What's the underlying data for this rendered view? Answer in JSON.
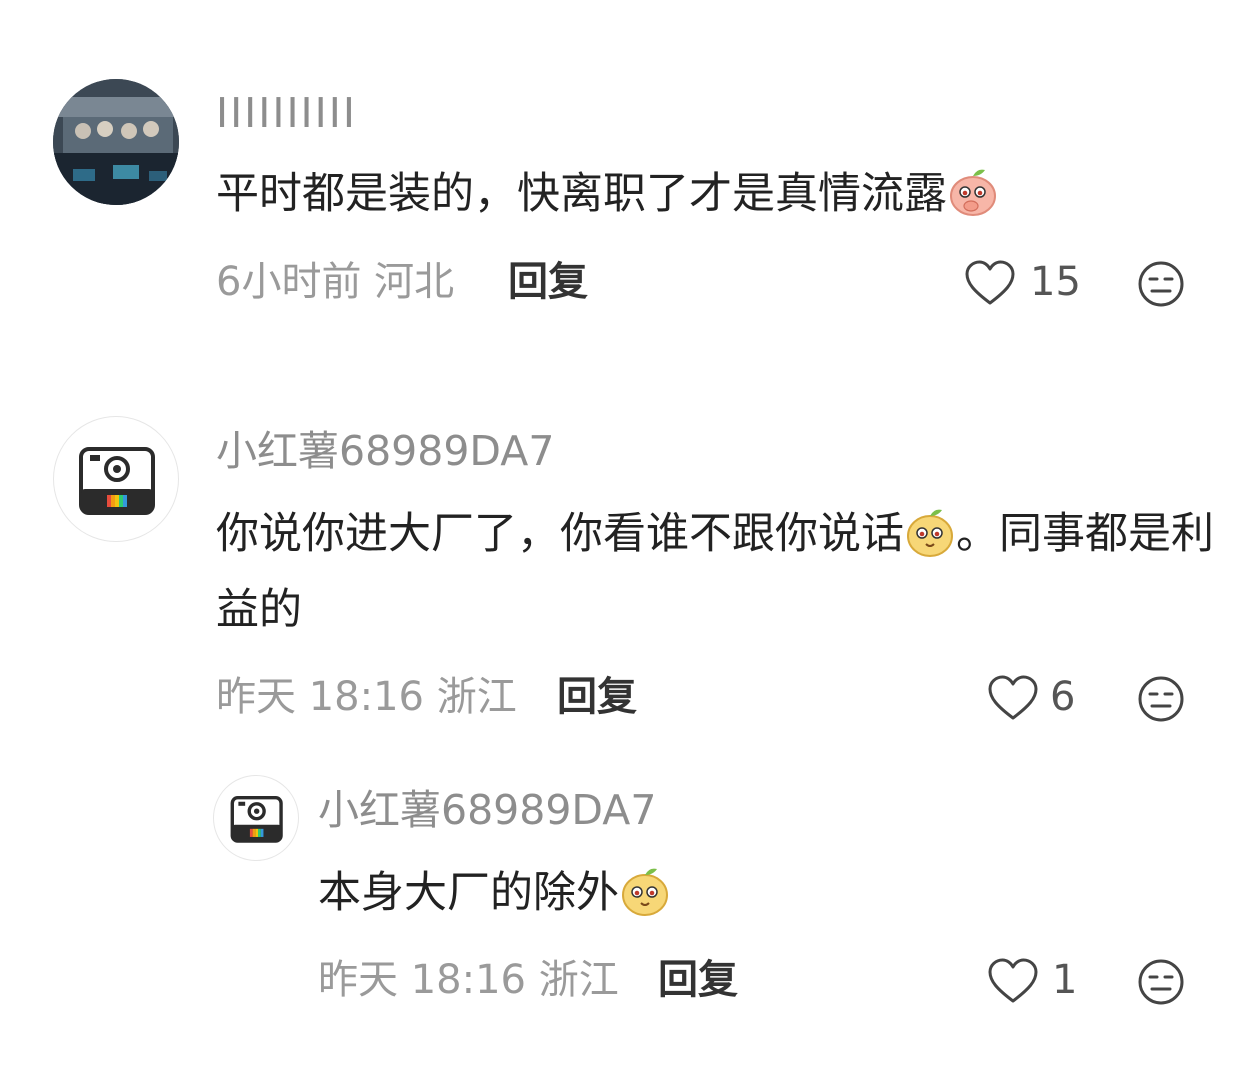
{
  "comments": [
    {
      "username": "IIIIIIIIII",
      "text_before": "平时都是装的，快离职了才是真情流露",
      "emoji1": "peach-emoji",
      "text_middle": "",
      "text_after": "",
      "time_location": "6小时前 河北",
      "reply_label": "回复",
      "likes": "15"
    },
    {
      "username": "小红薯68989DA7",
      "text_before": "你说你进大厂了，你看谁不跟你说话",
      "emoji1": "potato-emoji",
      "text_after": "。同事都是利益的",
      "time_location": "昨天 18:16 浙江",
      "reply_label": "回复",
      "likes": "6"
    },
    {
      "username": "小红薯68989DA7",
      "text_before": "本身大厂的除外",
      "emoji1": "potato-emoji",
      "time_location": "昨天 18:16 浙江",
      "reply_label": "回复",
      "likes": "1"
    }
  ],
  "icons": {
    "like": "heart-outline-icon",
    "dislike": "meh-face-icon"
  }
}
